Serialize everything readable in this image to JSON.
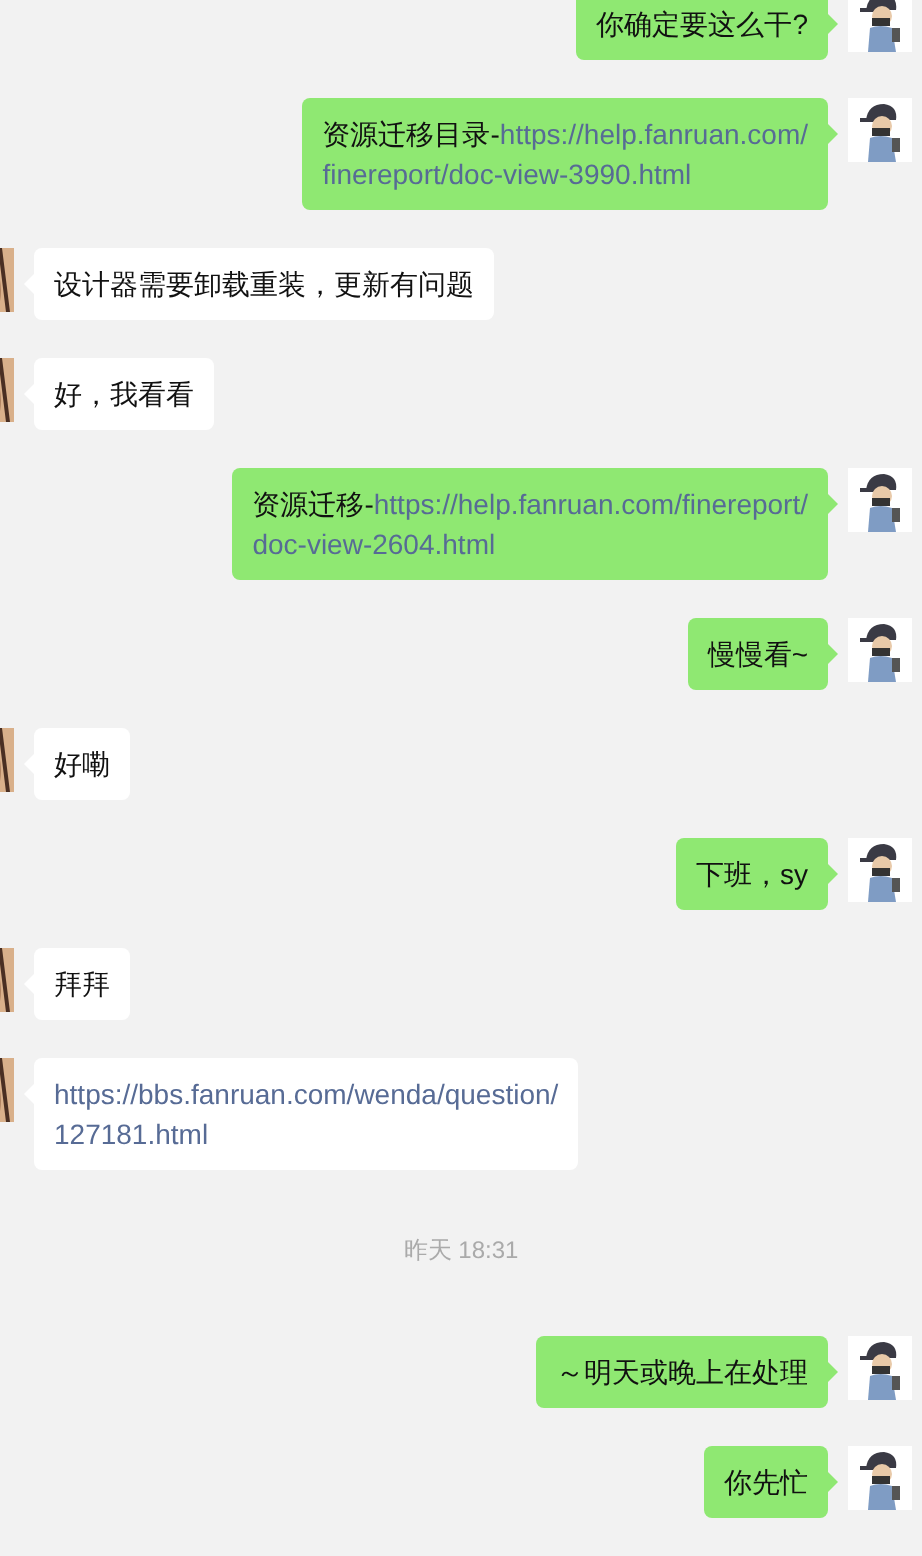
{
  "messages": [
    {
      "kind": "sent",
      "lines": [
        [
          {
            "kind": "text",
            "text": "你确定要这么干?"
          }
        ]
      ]
    },
    {
      "kind": "sent",
      "lines": [
        [
          {
            "kind": "text",
            "text": "资源迁移目录-"
          },
          {
            "kind": "link",
            "text": "https://help.fanruan.com/"
          }
        ],
        [
          {
            "kind": "link",
            "text": "finereport/doc-view-3990.html"
          }
        ]
      ]
    },
    {
      "kind": "received",
      "lines": [
        [
          {
            "kind": "text",
            "text": "设计器需要卸载重装，更新有问题"
          }
        ]
      ]
    },
    {
      "kind": "received",
      "lines": [
        [
          {
            "kind": "text",
            "text": "好，我看看"
          }
        ]
      ]
    },
    {
      "kind": "sent",
      "lines": [
        [
          {
            "kind": "text",
            "text": "资源迁移-"
          },
          {
            "kind": "link",
            "text": "https://help.fanruan.com/finereport/"
          }
        ],
        [
          {
            "kind": "link",
            "text": "doc-view-2604.html"
          }
        ]
      ]
    },
    {
      "kind": "sent",
      "lines": [
        [
          {
            "kind": "text",
            "text": "慢慢看~"
          }
        ]
      ]
    },
    {
      "kind": "received",
      "lines": [
        [
          {
            "kind": "text",
            "text": "好嘞"
          }
        ]
      ]
    },
    {
      "kind": "sent",
      "lines": [
        [
          {
            "kind": "text",
            "text": "下班，sy"
          }
        ]
      ]
    },
    {
      "kind": "received",
      "lines": [
        [
          {
            "kind": "text",
            "text": "拜拜"
          }
        ]
      ]
    },
    {
      "kind": "received",
      "lines": [
        [
          {
            "kind": "link",
            "text": "https://bbs.fanruan.com/wenda/question/"
          }
        ],
        [
          {
            "kind": "link",
            "text": "127181.html"
          }
        ]
      ]
    },
    {
      "kind": "timestamp",
      "text": "昨天 18:31"
    },
    {
      "kind": "sent",
      "lines": [
        [
          {
            "kind": "text",
            "text": "～明天或晚上在处理"
          }
        ]
      ]
    },
    {
      "kind": "sent",
      "lines": [
        [
          {
            "kind": "text",
            "text": "你先忙"
          }
        ]
      ]
    }
  ]
}
